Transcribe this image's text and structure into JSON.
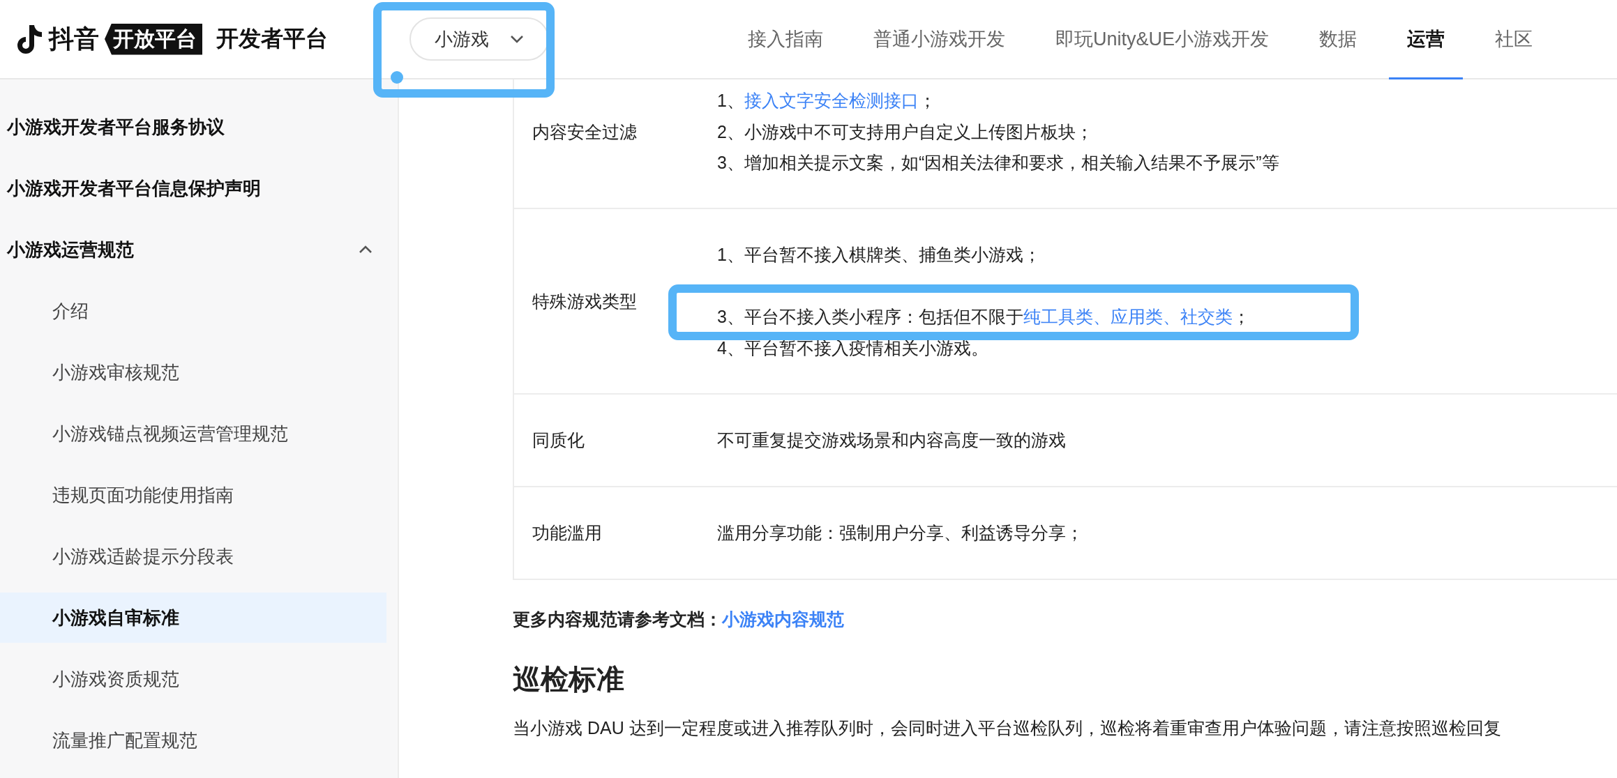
{
  "header": {
    "logo": {
      "brand": "抖音",
      "badge": "开放平台",
      "title": "开发者平台"
    },
    "product_select": {
      "value": "小游戏"
    },
    "nav": [
      {
        "label": "接入指南",
        "selected": false
      },
      {
        "label": "普通小游戏开发",
        "selected": false
      },
      {
        "label": "即玩Unity&UE小游戏开发",
        "selected": false
      },
      {
        "label": "数据",
        "selected": false
      },
      {
        "label": "运营",
        "selected": true
      },
      {
        "label": "社区",
        "selected": false
      }
    ]
  },
  "sidebar": {
    "items": [
      {
        "label": "小游戏开发者平台服务协议",
        "selected": false
      },
      {
        "label": "小游戏开发者平台信息保护声明",
        "selected": false
      },
      {
        "label": "小游戏运营规范",
        "selected": false,
        "expanded": true,
        "children": [
          {
            "label": "介绍",
            "selected": false
          },
          {
            "label": "小游戏审核规范",
            "selected": false
          },
          {
            "label": "小游戏锚点视频运营管理规范",
            "selected": false
          },
          {
            "label": "违规页面功能使用指南",
            "selected": false
          },
          {
            "label": "小游戏适龄提示分段表",
            "selected": false
          },
          {
            "label": "小游戏自审标准",
            "selected": true
          },
          {
            "label": "小游戏资质规范",
            "selected": false
          },
          {
            "label": "流量推广配置规范",
            "selected": false
          }
        ]
      }
    ]
  },
  "table": {
    "rows": [
      {
        "label": "内容安全过滤",
        "lines": [
          [
            {
              "text": "1、"
            },
            {
              "text": "接入文字安全检测接口",
              "kind": "link"
            },
            {
              "text": "；"
            }
          ],
          [
            {
              "text": "2、小游戏中不可支持用户自定义上传图片板块；"
            }
          ],
          [
            {
              "text": "3、增加相关提示文案，如“因相关法律和要求，相关输入结果不予展示”等"
            }
          ]
        ]
      },
      {
        "label": "特殊游戏类型",
        "lines": [
          [
            {
              "text": "1、平台暂不接入棋牌类、捕鱼类小游戏；"
            }
          ],
          [
            {
              "text": "3、平台不接入类小程序：包括但不限于"
            },
            {
              "text": "纯工具类、应用类、社交类",
              "kind": "link"
            },
            {
              "text": "；"
            }
          ],
          [
            {
              "text": "4、平台暂不接入疫情相关小游戏。"
            }
          ]
        ]
      },
      {
        "label": "同质化",
        "lines": [
          [
            {
              "text": "不可重复提交游戏场景和内容高度一致的游戏"
            }
          ]
        ]
      },
      {
        "label": "功能滥用",
        "lines": [
          [
            {
              "text": "滥用分享功能：强制用户分享、利益诱导分享；"
            }
          ]
        ]
      }
    ]
  },
  "more": {
    "text": "更多内容规范请参考文档：",
    "link": "小游戏内容规范"
  },
  "section": {
    "heading": "巡检标准",
    "paragraph": "当小游戏 DAU 达到一定程度或进入推荐队列时，会同时进入平台巡检队列，巡检将着重审查用户体验问题，请注意按照巡检回复"
  }
}
